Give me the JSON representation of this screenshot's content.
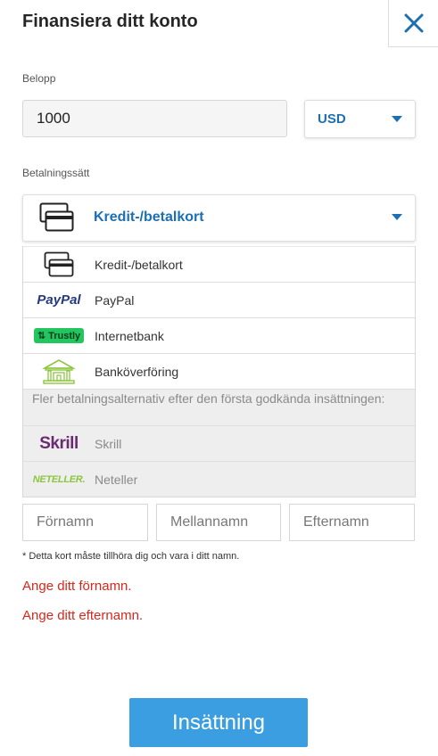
{
  "header": {
    "title": "Finansiera ditt konto"
  },
  "amount": {
    "label": "Belopp",
    "value": "1000",
    "currency": "USD"
  },
  "payment": {
    "label": "Betalningssätt",
    "selected": "Kredit-/betalkort",
    "options": [
      {
        "label": "Kredit-/betalkort",
        "icon": "credit-card-icon"
      },
      {
        "label": "PayPal",
        "icon": "paypal-logo",
        "logo_text": "PayPal"
      },
      {
        "label": "Internetbank",
        "icon": "trustly-logo",
        "logo_text": "Trustly"
      },
      {
        "label": "Banköverföring",
        "icon": "bank-icon"
      }
    ],
    "more_note": "Fler betalningsalternativ efter den första godkända insättningen:",
    "disabled_options": [
      {
        "label": "Skrill",
        "icon": "skrill-logo",
        "logo_text": "Skrill"
      },
      {
        "label": "Neteller",
        "icon": "neteller-logo",
        "logo_text": "NETELLER."
      }
    ]
  },
  "name": {
    "first_placeholder": "Förnamn",
    "middle_placeholder": "Mellannamn",
    "last_placeholder": "Efternamn",
    "hint": "* Detta kort måste tillhöra dig och vara i ditt namn."
  },
  "errors": {
    "first_name": "Ange ditt förnamn.",
    "last_name": "Ange ditt efternamn."
  },
  "submit_label": "Insättning",
  "colors": {
    "accent": "#1c6fb3",
    "button": "#3a9ee0",
    "error": "#d9261c"
  }
}
